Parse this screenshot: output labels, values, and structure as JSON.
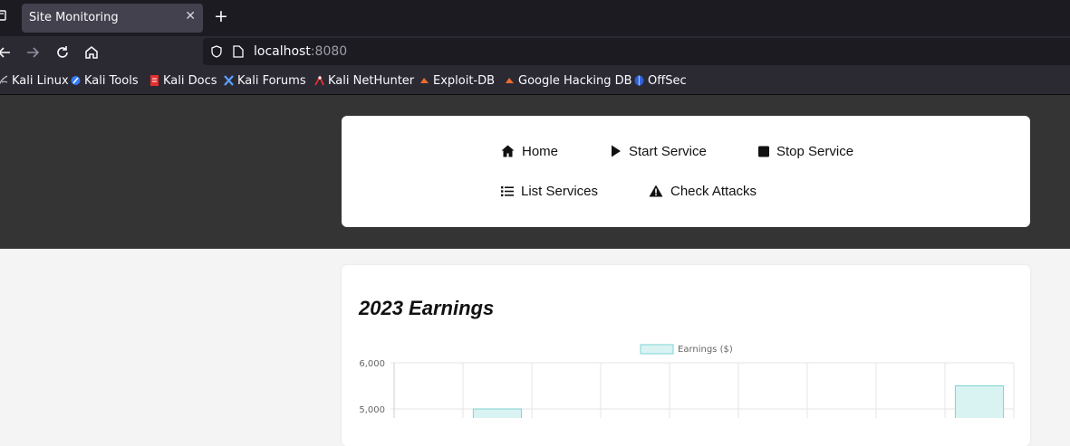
{
  "browser": {
    "tab_title": "Site Monitoring",
    "url_host": "localhost",
    "url_port": ":8080",
    "bookmarks": [
      "Kali Linux",
      "Kali Tools",
      "Kali Docs",
      "Kali Forums",
      "Kali NetHunter",
      "Exploit-DB",
      "Google Hacking DB",
      "OffSec"
    ]
  },
  "nav": {
    "home": "Home",
    "start": "Start Service",
    "stop": "Stop Service",
    "list": "List Services",
    "attacks": "Check Attacks"
  },
  "chart": {
    "title": "2023 Earnings"
  },
  "chart_data": {
    "type": "bar",
    "legend": "Earnings ($)",
    "legend_position": "top",
    "y_ticks": [
      "6,000",
      "5,000"
    ],
    "ylim_visible": [
      4800,
      6000
    ],
    "grid": true,
    "categories_count": 9,
    "values": [
      null,
      5000,
      null,
      null,
      null,
      null,
      null,
      null,
      5500
    ],
    "bar_fill": "#d9f3f3",
    "bar_stroke": "#7fd3d3"
  }
}
